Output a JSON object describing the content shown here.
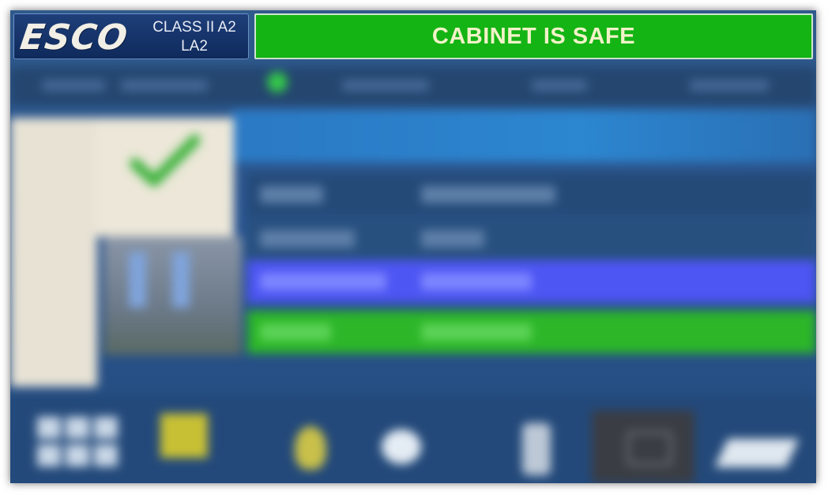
{
  "header": {
    "brand": "ESCO",
    "class_line1": "CLASS II A2",
    "class_line2": "LA2",
    "status": "CABINET IS SAFE"
  },
  "colors": {
    "status_banner": "#14b414",
    "row_blue": "#4d55f3",
    "row_green": "#2cb628",
    "background": "#2a5590"
  },
  "icons": [
    "grid-icon",
    "timer-icon",
    "lamp-icon",
    "fan-icon",
    "bottle-icon",
    "window-icon",
    "key-icon"
  ]
}
